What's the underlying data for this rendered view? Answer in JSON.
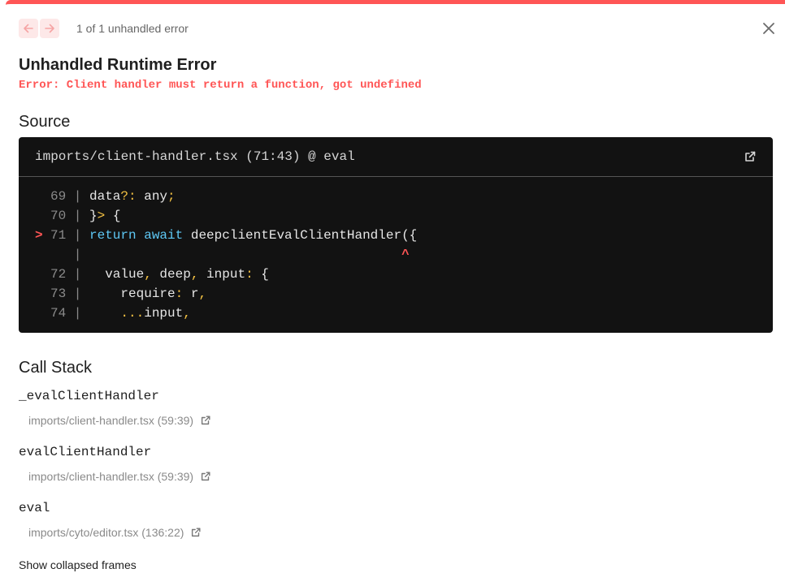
{
  "header": {
    "error_count": "1 of 1 unhandled error"
  },
  "error": {
    "title": "Unhandled Runtime Error",
    "message": "Error: Client handler must return a function, got undefined"
  },
  "source": {
    "heading": "Source",
    "file": "imports/client-handler.tsx (71:43) @ eval",
    "lines": [
      {
        "mark": "",
        "num": "69",
        "sep": "|",
        "tokens": [
          {
            "t": "data",
            "c": "w"
          },
          {
            "t": "?:",
            "c": "y"
          },
          {
            "t": " any",
            "c": "w"
          },
          {
            "t": ";",
            "c": "y"
          }
        ]
      },
      {
        "mark": "",
        "num": "70",
        "sep": "|",
        "tokens": [
          {
            "t": "}",
            "c": "w"
          },
          {
            "t": ">",
            "c": "y"
          },
          {
            "t": " {",
            "c": "w"
          }
        ]
      },
      {
        "mark": ">",
        "num": "71",
        "sep": "|",
        "tokens": [
          {
            "t": "return",
            "c": "b"
          },
          {
            "t": " ",
            "c": "w"
          },
          {
            "t": "await",
            "c": "b"
          },
          {
            "t": " deepclientEvalClientHandler({",
            "c": "w"
          }
        ]
      },
      {
        "mark": "",
        "num": "",
        "sep": "|",
        "tokens": [
          {
            "t": "                                        ",
            "c": "w"
          },
          {
            "t": "^",
            "c": "r"
          }
        ]
      },
      {
        "mark": "",
        "num": "72",
        "sep": "|",
        "tokens": [
          {
            "t": "  value",
            "c": "w"
          },
          {
            "t": ",",
            "c": "y"
          },
          {
            "t": " deep",
            "c": "w"
          },
          {
            "t": ",",
            "c": "y"
          },
          {
            "t": " input",
            "c": "w"
          },
          {
            "t": ":",
            "c": "y"
          },
          {
            "t": " {",
            "c": "w"
          }
        ]
      },
      {
        "mark": "",
        "num": "73",
        "sep": "|",
        "tokens": [
          {
            "t": "    require",
            "c": "w"
          },
          {
            "t": ":",
            "c": "y"
          },
          {
            "t": " r",
            "c": "w"
          },
          {
            "t": ",",
            "c": "y"
          }
        ]
      },
      {
        "mark": "",
        "num": "74",
        "sep": "|",
        "tokens": [
          {
            "t": "    ",
            "c": "w"
          },
          {
            "t": "...",
            "c": "y"
          },
          {
            "t": "input",
            "c": "w"
          },
          {
            "t": ",",
            "c": "y"
          }
        ]
      }
    ]
  },
  "call_stack": {
    "heading": "Call Stack",
    "frames": [
      {
        "fn": "_evalClientHandler",
        "loc": "imports/client-handler.tsx (59:39)"
      },
      {
        "fn": "evalClientHandler",
        "loc": "imports/client-handler.tsx (59:39)"
      },
      {
        "fn": "eval",
        "loc": "imports/cyto/editor.tsx (136:22)"
      }
    ],
    "show_collapsed": "Show collapsed frames"
  },
  "colors": {
    "accent": "#ff5555",
    "code_bg": "#121212",
    "keyword": "#5ec8f5",
    "punct": "#f6c343"
  },
  "icons": {
    "prev": "arrow-left-icon",
    "next": "arrow-right-icon",
    "close": "close-icon",
    "open_in_editor": "external-link-icon"
  }
}
